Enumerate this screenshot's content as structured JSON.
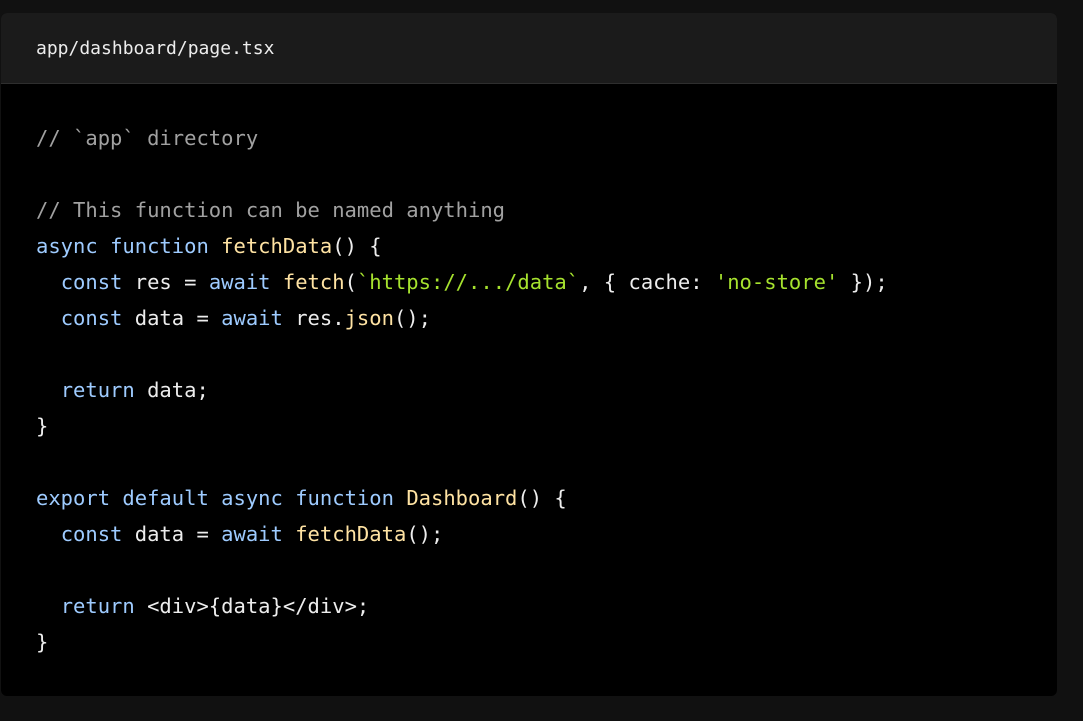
{
  "file": {
    "name": "app/dashboard/page.tsx"
  },
  "code": {
    "lines": [
      [
        {
          "t": "comment",
          "v": "// `app` directory"
        }
      ],
      [],
      [
        {
          "t": "comment",
          "v": "// This function can be named anything"
        }
      ],
      [
        {
          "t": "keyword",
          "v": "async"
        },
        {
          "t": "plain",
          "v": " "
        },
        {
          "t": "keyword",
          "v": "function"
        },
        {
          "t": "plain",
          "v": " "
        },
        {
          "t": "function",
          "v": "fetchData"
        },
        {
          "t": "plain",
          "v": "() {"
        }
      ],
      [
        {
          "t": "plain",
          "v": "  "
        },
        {
          "t": "keyword",
          "v": "const"
        },
        {
          "t": "plain",
          "v": " res = "
        },
        {
          "t": "keyword",
          "v": "await"
        },
        {
          "t": "plain",
          "v": " "
        },
        {
          "t": "function",
          "v": "fetch"
        },
        {
          "t": "plain",
          "v": "("
        },
        {
          "t": "string",
          "v": "`https://.../data`"
        },
        {
          "t": "plain",
          "v": ", { cache: "
        },
        {
          "t": "string",
          "v": "'no-store'"
        },
        {
          "t": "plain",
          "v": " });"
        }
      ],
      [
        {
          "t": "plain",
          "v": "  "
        },
        {
          "t": "keyword",
          "v": "const"
        },
        {
          "t": "plain",
          "v": " data = "
        },
        {
          "t": "keyword",
          "v": "await"
        },
        {
          "t": "plain",
          "v": " res."
        },
        {
          "t": "function",
          "v": "json"
        },
        {
          "t": "plain",
          "v": "();"
        }
      ],
      [],
      [
        {
          "t": "plain",
          "v": "  "
        },
        {
          "t": "keyword",
          "v": "return"
        },
        {
          "t": "plain",
          "v": " data;"
        }
      ],
      [
        {
          "t": "plain",
          "v": "}"
        }
      ],
      [],
      [
        {
          "t": "keyword",
          "v": "export"
        },
        {
          "t": "plain",
          "v": " "
        },
        {
          "t": "keyword",
          "v": "default"
        },
        {
          "t": "plain",
          "v": " "
        },
        {
          "t": "keyword",
          "v": "async"
        },
        {
          "t": "plain",
          "v": " "
        },
        {
          "t": "keyword",
          "v": "function"
        },
        {
          "t": "plain",
          "v": " "
        },
        {
          "t": "function",
          "v": "Dashboard"
        },
        {
          "t": "plain",
          "v": "() {"
        }
      ],
      [
        {
          "t": "plain",
          "v": "  "
        },
        {
          "t": "keyword",
          "v": "const"
        },
        {
          "t": "plain",
          "v": " data = "
        },
        {
          "t": "keyword",
          "v": "await"
        },
        {
          "t": "plain",
          "v": " "
        },
        {
          "t": "function",
          "v": "fetchData"
        },
        {
          "t": "plain",
          "v": "();"
        }
      ],
      [],
      [
        {
          "t": "plain",
          "v": "  "
        },
        {
          "t": "keyword",
          "v": "return"
        },
        {
          "t": "plain",
          "v": " <div>{data}</div>;"
        }
      ],
      [
        {
          "t": "plain",
          "v": "}"
        }
      ]
    ]
  },
  "colors": {
    "page_background": "#111111",
    "code_background": "#000000",
    "header_background": "#1b1b1b",
    "comment": "#a1a1a1",
    "keyword": "#9ecbff",
    "function": "#ffe3a3",
    "string": "#a6e22e",
    "plain": "#ededed"
  }
}
